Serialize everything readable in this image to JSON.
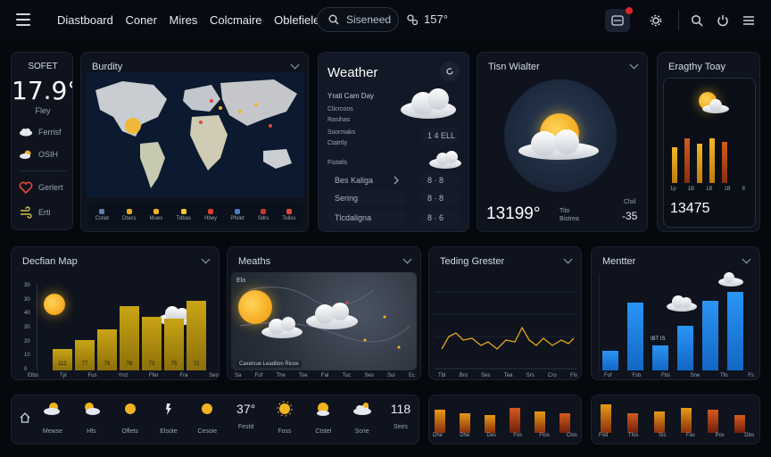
{
  "topbar": {
    "nav": [
      "Diastboard",
      "Coner",
      "Mires",
      "Colcmaire",
      "Oblefieles"
    ],
    "search_label": "Siseneed",
    "temperature": "157°"
  },
  "current": {
    "label": "SOFET",
    "temp": "17.9°",
    "sub": "Fley",
    "items": [
      {
        "icon": "cloud-icon",
        "label": "Ferrisf"
      },
      {
        "icon": "sun-cloud-icon",
        "label": "OSIH"
      },
      {
        "icon": "heart-icon",
        "label": "Gerlert"
      },
      {
        "icon": "wind-icon",
        "label": "Erti"
      }
    ]
  },
  "map_card": {
    "title": "Burdity",
    "legend": [
      "Cstiat",
      "Dtacs",
      "Mues",
      "Tdbas",
      "Hbey",
      "Pfolet",
      "Sdrs",
      "Toliss"
    ]
  },
  "weather_card": {
    "title": "Weather",
    "rows": [
      "Yrati Cam Day",
      "Clicrcoos",
      "Rasihas",
      "Ssormaks",
      "Ctatrtly",
      "Fistatls"
    ],
    "pill1": "1 4 ELL",
    "selects": [
      {
        "label": "Bes Kaliga",
        "value": "8 · 8"
      },
      {
        "label": "Sering",
        "value": "8 · 8"
      },
      {
        "label": "Tlcdaligna",
        "value": "8 · 6"
      }
    ]
  },
  "twin_card": {
    "title": "Tisn Wialter",
    "big": "13199°",
    "sub1": "Tito",
    "sub2": "Bistrea",
    "right": "-35",
    "right_label": "Clsil"
  },
  "daily_card": {
    "title": "Eragthy Toay",
    "value": "13475",
    "bar_labels": [
      "1p",
      "1B",
      "1B",
      "1B",
      "8"
    ]
  },
  "decline_card": {
    "title": "Decfian Map",
    "y_ticks": [
      "30",
      "30",
      "40",
      "30",
      "20",
      "10",
      "0"
    ],
    "bar_labels": [
      "112",
      "77",
      "79",
      "78",
      "73",
      "75",
      "72"
    ],
    "x_labels": [
      "Elbo",
      "Tyl",
      "Fus",
      "Yrct",
      "Ffer",
      "Fra",
      "Seo"
    ]
  },
  "meaths_card": {
    "title": "Meaths",
    "map_label": "Elo",
    "footer": "Caxelcue Leadtion Ricoe",
    "x_labels": [
      "Sa",
      "Fof",
      "The",
      "Toe",
      "Fal",
      "Tuc",
      "Ses",
      "Sui",
      "Ec"
    ]
  },
  "trend_card": {
    "title": "Teding Grester",
    "x_labels": [
      "Tbl",
      "Bro",
      "Ses",
      "Tea",
      "Srs",
      "Cro",
      "Fis"
    ]
  },
  "mentor_card": {
    "title": "Mentter",
    "bar_label": "IBT IS",
    "x_labels": [
      "Fof",
      "Fsb",
      "Fbs",
      "Sne",
      "Tfo",
      "Fs"
    ]
  },
  "forecast_strip": {
    "items": [
      {
        "icon": "home-icon",
        "label": ""
      },
      {
        "icon": "sun-cloud-icon",
        "label": "Mewse"
      },
      {
        "icon": "sun-cloud-icon",
        "label": "Hfs"
      },
      {
        "icon": "sun-icon",
        "label": "Oflets"
      },
      {
        "icon": "rain-icon",
        "label": "Elsote"
      },
      {
        "icon": "sun-icon",
        "label": "Cesoie"
      },
      {
        "icon": "text",
        "label": "Festd",
        "value": "37°"
      },
      {
        "icon": "sun-icon",
        "label": "Foss"
      },
      {
        "icon": "sun-cloud-icon",
        "label": "Ctstel"
      },
      {
        "icon": "cloud-icon",
        "label": "Scrie"
      },
      {
        "icon": "text",
        "label": "Seirs",
        "value": "118"
      }
    ]
  },
  "bottom_bars1": {
    "labels": [
      "Dhe",
      "Dhe",
      "Des",
      "Fos",
      "Flos",
      "Clos"
    ]
  },
  "bottom_bars2": {
    "labels": [
      "Fod",
      "Tfos",
      "Sis",
      "Fas",
      "Pos",
      "Dbs"
    ]
  },
  "colors": {
    "accent_blue": "#1a7fe0",
    "accent_gold": "#c9a514",
    "accent_orange": "#e69b17",
    "bg": "#05080d"
  }
}
